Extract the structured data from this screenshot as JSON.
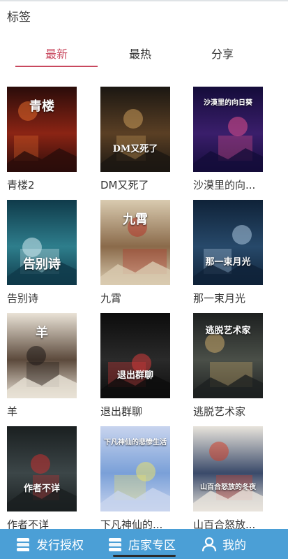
{
  "header": {
    "title": "标签"
  },
  "tabs": [
    {
      "label": "最新",
      "active": true
    },
    {
      "label": "最热",
      "active": false
    },
    {
      "label": "分享",
      "active": false
    }
  ],
  "accent_color": "#c8485e",
  "bar_color": "#4b9fd6",
  "books": [
    {
      "title": "青楼2",
      "cover_text": "青楼",
      "cover_palette": [
        "#2a0c0a",
        "#8b2414",
        "#e0672a"
      ]
    },
    {
      "title": "DM又死了",
      "cover_text": "DM又死了",
      "cover_palette": [
        "#1b1712",
        "#5a3f24",
        "#c89a5a"
      ]
    },
    {
      "title": "沙漠里的向...",
      "cover_text": "沙漠里的向日葵",
      "cover_palette": [
        "#140c3a",
        "#3a1e6b",
        "#e04f8a"
      ]
    },
    {
      "title": "告别诗",
      "cover_text": "告别诗",
      "cover_palette": [
        "#0f3a4a",
        "#2e7e8c",
        "#cfeaf0"
      ]
    },
    {
      "title": "九霄",
      "cover_text": "九霄",
      "cover_palette": [
        "#d9cbb0",
        "#8a6a4a",
        "#b4372a"
      ]
    },
    {
      "title": "那一束月光",
      "cover_text": "那一束月光",
      "cover_palette": [
        "#0f2238",
        "#27496a",
        "#aac4dc"
      ]
    },
    {
      "title": "羊",
      "cover_text": "羊",
      "cover_palette": [
        "#e9e2d6",
        "#5c4a3c",
        "#1f1a18"
      ]
    },
    {
      "title": "退出群聊",
      "cover_text": "退出群聊",
      "cover_palette": [
        "#0c0c0c",
        "#2a2a2a",
        "#d43a3a"
      ]
    },
    {
      "title": "逃脱艺术家",
      "cover_text": "逃脱艺术家",
      "cover_palette": [
        "#1d2020",
        "#4a4f48",
        "#c9a86a"
      ]
    },
    {
      "title": "作者不详",
      "cover_text": "作者不详",
      "cover_palette": [
        "#1a1f20",
        "#3c4648",
        "#c43030"
      ]
    },
    {
      "title": "下凡神仙的...",
      "cover_text": "下凡神仙的悲惨生活",
      "cover_palette": [
        "#c8d4ee",
        "#7aa0d8",
        "#e8e070"
      ]
    },
    {
      "title": "山百合怒放...",
      "cover_text": "山百合怒放的冬夜",
      "cover_palette": [
        "#e8e4dc",
        "#3a4a6a",
        "#d0402a"
      ]
    }
  ],
  "bottom_nav": [
    {
      "label": "发行授权",
      "icon": "stack-icon"
    },
    {
      "label": "店家专区",
      "icon": "store-icon"
    },
    {
      "label": "我的",
      "icon": "user-icon"
    }
  ]
}
